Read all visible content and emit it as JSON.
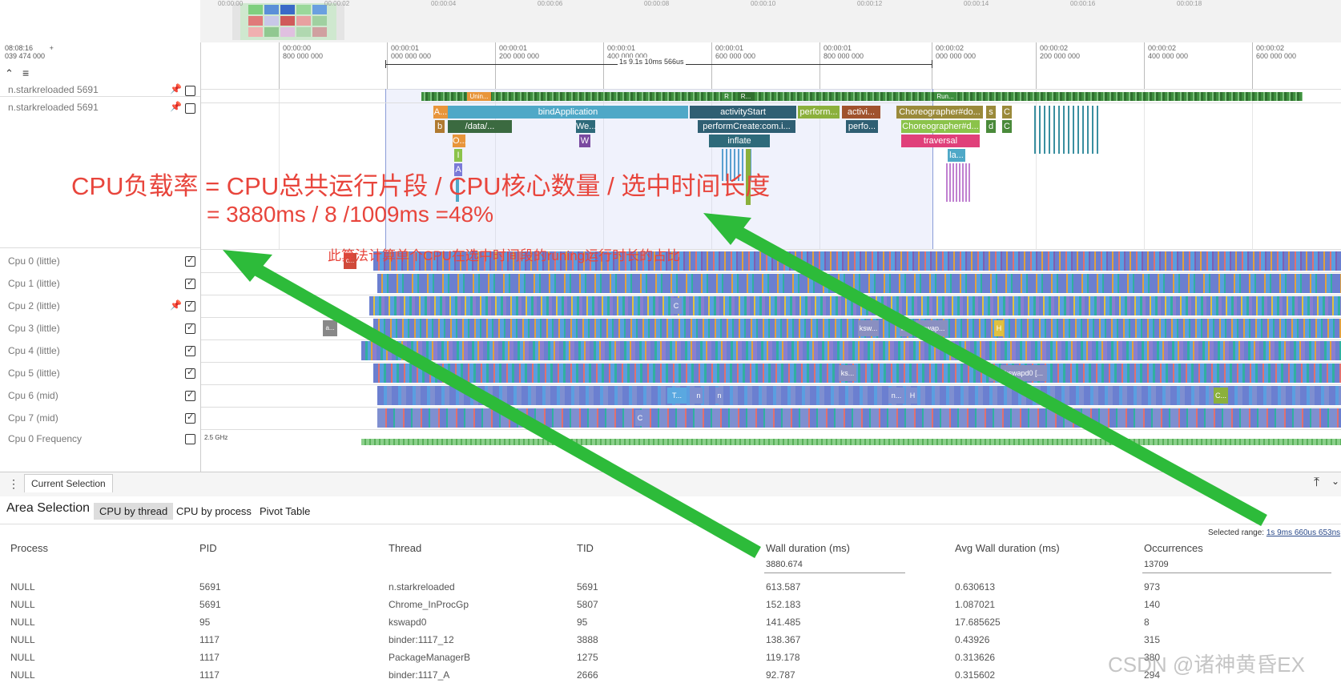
{
  "overview": {
    "ticks": [
      "00:00:00",
      "00:00:02",
      "00:00:04",
      "00:00:06",
      "00:00:08",
      "00:00:10",
      "00:00:12",
      "00:00:14",
      "00:00:16",
      "00:00:18"
    ]
  },
  "timeline": {
    "origin_line1": "08:08:16",
    "origin_line2": "039 474 000",
    "origin_plus": "+",
    "ruler_ticks": [
      {
        "l1": "00:00:00",
        "l2": "800 000 000"
      },
      {
        "l1": "00:00:01",
        "l2": "000 000 000"
      },
      {
        "l1": "00:00:01",
        "l2": "200 000 000"
      },
      {
        "l1": "00:00:01",
        "l2": "400 000 000"
      },
      {
        "l1": "00:00:01",
        "l2": "600 000 000"
      },
      {
        "l1": "00:00:01",
        "l2": "800 000 000"
      },
      {
        "l1": "00:00:02",
        "l2": "000 000 000"
      },
      {
        "l1": "00:00:02",
        "l2": "200 000 000"
      },
      {
        "l1": "00:00:02",
        "l2": "400 000 000"
      },
      {
        "l1": "00:00:02",
        "l2": "600 000 000"
      }
    ],
    "selection_label": "1s 9.1s 10ms 566us"
  },
  "tracks": {
    "process_rows": [
      "n.starkreloaded 5691",
      "n.starkreloaded 5691"
    ],
    "cpu_rows": [
      "Cpu 0 (little)",
      "Cpu 1 (little)",
      "Cpu 2 (little)",
      "Cpu 3 (little)",
      "Cpu 4 (little)",
      "Cpu 5 (little)",
      "Cpu 6 (mid)",
      "Cpu 7 (mid)"
    ],
    "freq_row": "Cpu 0 Frequency",
    "freq_value": "2.5 GHz"
  },
  "slices": {
    "row1": [
      "Unin...",
      "R",
      "R...",
      "Run..."
    ],
    "main": [
      {
        "label": "A...",
        "color": "#e8953a"
      },
      {
        "label": "bindApplication",
        "color": "#4fa8c7"
      },
      {
        "label": "activityStart",
        "color": "#2f5f73"
      },
      {
        "label": "perform...",
        "color": "#8bb03c"
      },
      {
        "label": "activi...",
        "color": "#a0522d"
      },
      {
        "label": "Choreographer#do...",
        "color": "#9a8a3a"
      },
      {
        "label": "s",
        "color": "#9a8a3a"
      },
      {
        "label": "C",
        "color": "#9a8a3a"
      },
      {
        "label": "b",
        "color": "#b07a30"
      },
      {
        "label": "/data/...",
        "color": "#3b6a40"
      },
      {
        "label": "We...",
        "color": "#2e6a7a"
      },
      {
        "label": "performCreate:com.i...",
        "color": "#2f5f73"
      },
      {
        "label": "perfo...",
        "color": "#2f5f73"
      },
      {
        "label": "Choreographer#d...",
        "color": "#8bc34a"
      },
      {
        "label": "d",
        "color": "#4a8a3a"
      },
      {
        "label": "C",
        "color": "#4a8a3a"
      },
      {
        "label": "O...",
        "color": "#e8953a"
      },
      {
        "label": "W",
        "color": "#7a4aa0"
      },
      {
        "label": "inflate",
        "color": "#2e6a7a"
      },
      {
        "label": "traversal",
        "color": "#e0407a"
      },
      {
        "label": "I",
        "color": "#8bc34a"
      },
      {
        "label": "la...",
        "color": "#4fa8c7"
      },
      {
        "label": "A",
        "color": "#7a7ad8"
      }
    ],
    "cpu_labels": [
      "c...",
      "C",
      "a...",
      "ksw...",
      "k...",
      "kswap...",
      "H",
      "ks...",
      "k",
      "kswapd0 [...",
      "T...",
      "n",
      "n",
      "n...",
      "H",
      "C...",
      "C",
      "H"
    ]
  },
  "panel": {
    "tab": "Current Selection",
    "title": "Area Selection",
    "subtabs": [
      "CPU by thread",
      "CPU by process",
      "Pivot Table"
    ],
    "selected_range_label": "Selected range:",
    "selected_range_value": "1s 9ms 660us 653ns",
    "columns": [
      "Process",
      "PID",
      "Thread",
      "TID",
      "Wall duration (ms)",
      "Avg Wall duration (ms)",
      "Occurrences"
    ],
    "totals": {
      "wall": "3880.674",
      "occurrences": "13709"
    },
    "rows": [
      [
        "NULL",
        "5691",
        "n.starkreloaded",
        "5691",
        "613.587",
        "0.630613",
        "973"
      ],
      [
        "NULL",
        "5691",
        "Chrome_InProcGp",
        "5807",
        "152.183",
        "1.087021",
        "140"
      ],
      [
        "NULL",
        "95",
        "kswapd0",
        "95",
        "141.485",
        "17.685625",
        "8"
      ],
      [
        "NULL",
        "1117",
        "binder:1117_12",
        "3888",
        "138.367",
        "0.43926",
        "315"
      ],
      [
        "NULL",
        "1117",
        "PackageManagerB",
        "1275",
        "119.178",
        "0.313626",
        "380"
      ],
      [
        "NULL",
        "1117",
        "binder:1117_A",
        "2666",
        "92.787",
        "0.315602",
        "294"
      ]
    ]
  },
  "annotation": {
    "formula": "CPU负载率 = CPU总共运行片段 / CPU核心数量 / 选中时间长度",
    "calc": "=  3880ms   /  8  /1009ms =48%",
    "note": "此算法计算单个CPU在选中时间段的runing运行时长的占比"
  },
  "watermark": "CSDN @诸神黄昏EX",
  "colors": {
    "annotation": "#e8453c",
    "arrow": "#2dbb3a",
    "selection": "#8a9cd8"
  }
}
